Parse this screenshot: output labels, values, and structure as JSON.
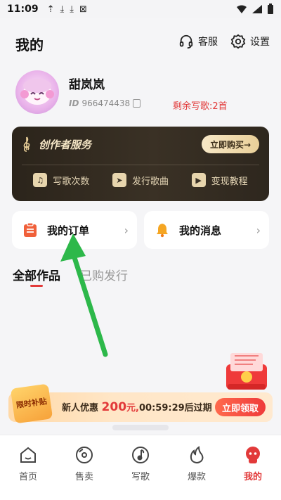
{
  "status_bar": {
    "time": "11:09",
    "glyphs": [
      "⇡",
      "⤓",
      "⤓",
      "⊠"
    ]
  },
  "header": {
    "title": "我的",
    "customer_service_label": "客服",
    "settings_label": "设置"
  },
  "profile": {
    "name": "甜岚岚",
    "id_prefix": "ID",
    "id_value": "966474438",
    "remaining_label": "剩余写歌:2首"
  },
  "creator_service": {
    "title": "创作者服务",
    "buy_label": "立即购买→",
    "items": [
      {
        "label": "写歌次数",
        "icon": "song-count-icon"
      },
      {
        "label": "发行歌曲",
        "icon": "send-icon"
      },
      {
        "label": "变现教程",
        "icon": "play-icon"
      }
    ]
  },
  "menu": {
    "orders_label": "我的订单",
    "messages_label": "我的消息"
  },
  "tabs": [
    {
      "label": "全部作品",
      "active": true
    },
    {
      "label": "已购发行",
      "active": false
    }
  ],
  "promo": {
    "badge": "限时补贴",
    "prefix": "新人优惠",
    "amount": "200",
    "unit": "元,",
    "countdown": "00:59:29",
    "suffix": "后过期",
    "button_label": "立即领取"
  },
  "bottom_nav": [
    {
      "label": "首页",
      "icon": "home-icon",
      "active": false
    },
    {
      "label": "售卖",
      "icon": "vinyl-icon",
      "active": false
    },
    {
      "label": "写歌",
      "icon": "music-note-icon",
      "active": false
    },
    {
      "label": "爆款",
      "icon": "flame-icon",
      "active": false
    },
    {
      "label": "我的",
      "icon": "user-icon",
      "active": true
    }
  ],
  "colors": {
    "accent_red": "#e23a3a",
    "creator_card_bg": "#2b241b",
    "gold": "#e9cf98",
    "annotation_arrow": "#2db84a"
  }
}
